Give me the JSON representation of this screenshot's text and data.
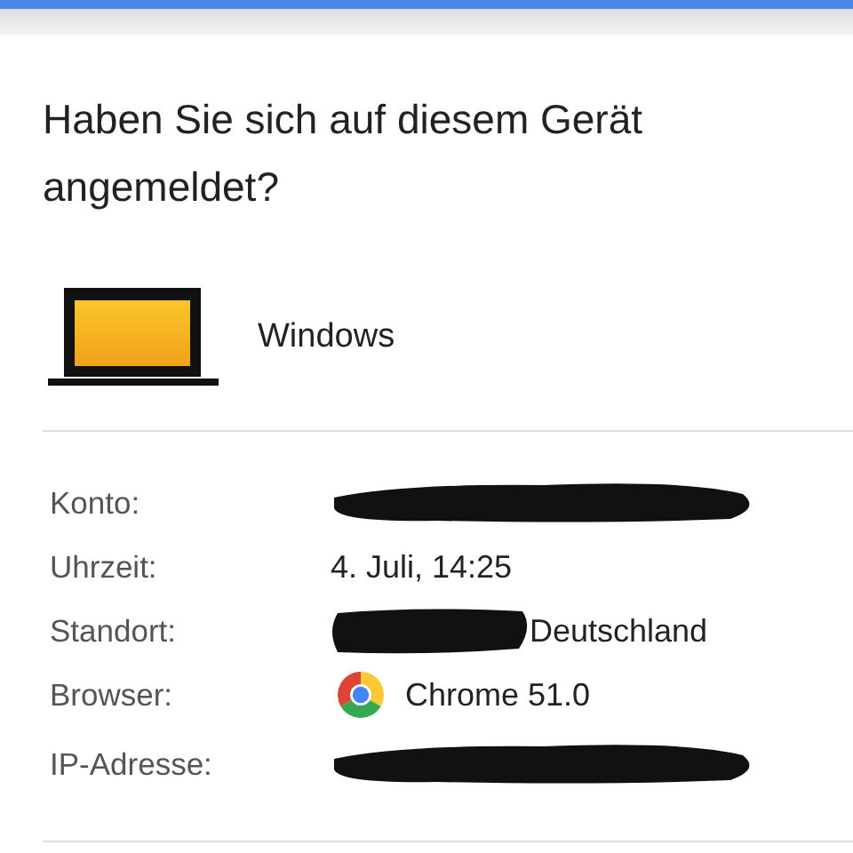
{
  "title": "Haben Sie sich auf diesem Gerät angemeldet?",
  "device": {
    "name": "Windows"
  },
  "details": [
    {
      "label": "Konto:",
      "kind": "redacted"
    },
    {
      "label": "Uhrzeit:",
      "kind": "text",
      "value": "4. Juli, 14:25"
    },
    {
      "label": "Standort:",
      "kind": "redacted_text",
      "value": "Deutschland"
    },
    {
      "label": "Browser:",
      "kind": "browser",
      "value": "Chrome 51.0"
    },
    {
      "label": "IP-Adresse:",
      "kind": "redacted"
    }
  ]
}
